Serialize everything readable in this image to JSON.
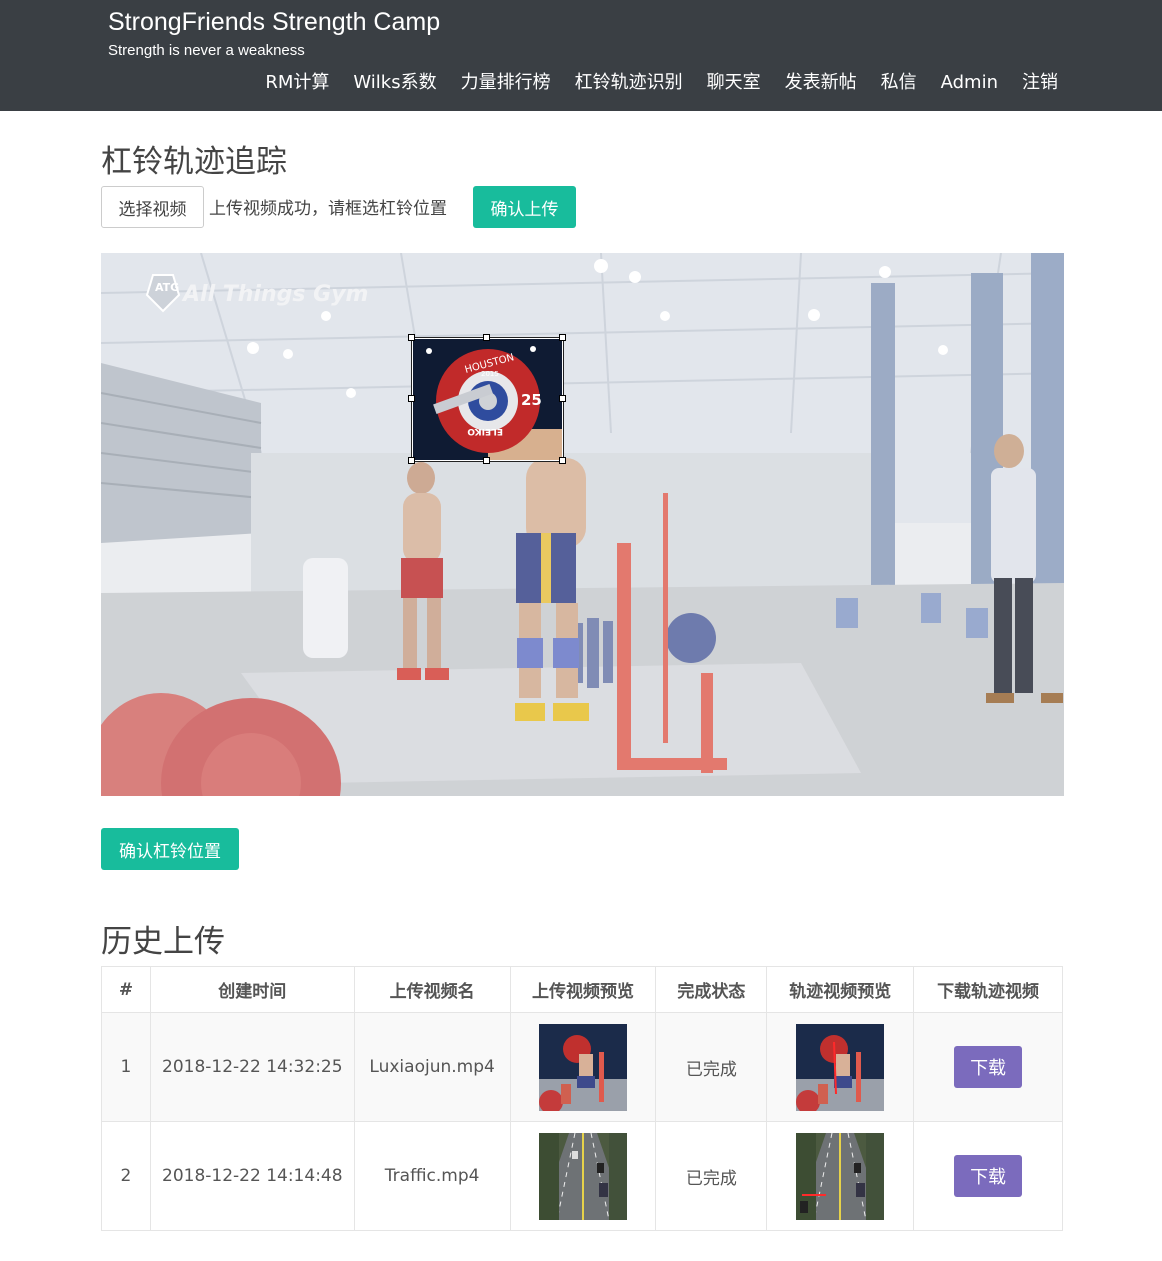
{
  "brand": {
    "title": "StrongFriends Strength Camp",
    "subtitle": "Strength is never a weakness"
  },
  "nav": [
    "RM计算",
    "Wilks系数",
    "力量排行榜",
    "杠铃轨迹识别",
    "聊天室",
    "发表新帖",
    "私信",
    "Admin",
    "注销"
  ],
  "page": {
    "title": "杠铃轨迹追踪",
    "choose_video_label": "选择视频",
    "status_text": "上传视频成功，请框选杠铃位置",
    "confirm_upload_label": "确认上传",
    "confirm_position_label": "确认杠铃位置",
    "video_watermark": "All Things Gym",
    "video_logo": "ATG",
    "plate_top": "HOUSTON",
    "plate_year": "2015",
    "plate_number": "25",
    "plate_brand": "ELEIKO"
  },
  "history": {
    "title": "历史上传",
    "headers": [
      "#",
      "创建时间",
      "上传视频名",
      "上传视频预览",
      "完成状态",
      "轨迹视频预览",
      "下载轨迹视频"
    ],
    "rows": [
      {
        "num": "1",
        "created": "2018-12-22 14:32:25",
        "name": "Luxiaojun.mp4",
        "status": "已完成",
        "download": "下载"
      },
      {
        "num": "2",
        "created": "2018-12-22 14:14:48",
        "name": "Traffic.mp4",
        "status": "已完成",
        "download": "下载"
      }
    ]
  },
  "colors": {
    "navbar": "#3a3f44",
    "success": "#18bc9c",
    "download": "#7b6bbd"
  }
}
